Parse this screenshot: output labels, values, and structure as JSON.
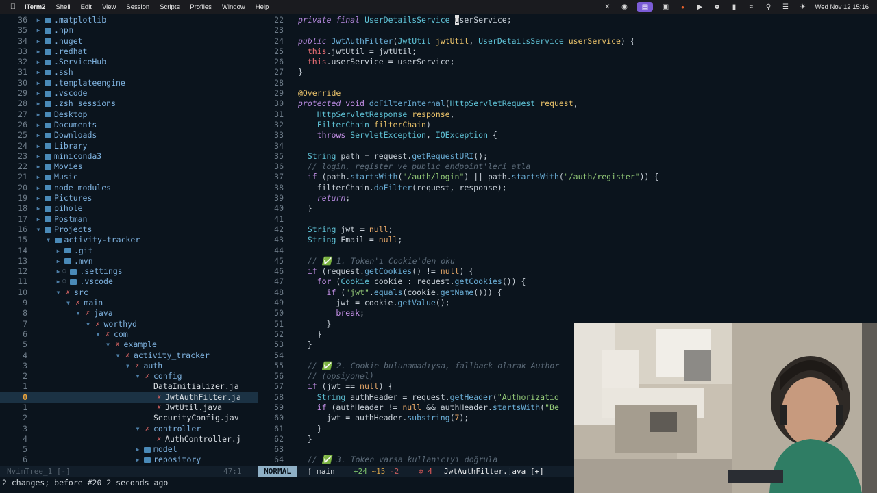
{
  "menubar": {
    "app_name": "iTerm2",
    "items": [
      "Shell",
      "Edit",
      "View",
      "Session",
      "Scripts",
      "Profiles",
      "Window",
      "Help"
    ],
    "clock": "Wed Nov 12  15:16"
  },
  "tree": {
    "rows": [
      {
        "rel": "36",
        "name": ".matplotlib",
        "depth": 0,
        "kind": "dir"
      },
      {
        "rel": "35",
        "name": ".npm",
        "depth": 0,
        "kind": "dir"
      },
      {
        "rel": "34",
        "name": ".nuget",
        "depth": 0,
        "kind": "dir"
      },
      {
        "rel": "33",
        "name": ".redhat",
        "depth": 0,
        "kind": "dir"
      },
      {
        "rel": "32",
        "name": ".ServiceHub",
        "depth": 0,
        "kind": "dir"
      },
      {
        "rel": "31",
        "name": ".ssh",
        "depth": 0,
        "kind": "dir"
      },
      {
        "rel": "30",
        "name": ".templateengine",
        "depth": 0,
        "kind": "dir"
      },
      {
        "rel": "29",
        "name": ".vscode",
        "depth": 0,
        "kind": "dir"
      },
      {
        "rel": "28",
        "name": ".zsh_sessions",
        "depth": 0,
        "kind": "dir"
      },
      {
        "rel": "27",
        "name": "Desktop",
        "depth": 0,
        "kind": "dir"
      },
      {
        "rel": "26",
        "name": "Documents",
        "depth": 0,
        "kind": "dir"
      },
      {
        "rel": "25",
        "name": "Downloads",
        "depth": 0,
        "kind": "dir"
      },
      {
        "rel": "24",
        "name": "Library",
        "depth": 0,
        "kind": "dir"
      },
      {
        "rel": "23",
        "name": "miniconda3",
        "depth": 0,
        "kind": "dir"
      },
      {
        "rel": "22",
        "name": "Movies",
        "depth": 0,
        "kind": "dir"
      },
      {
        "rel": "21",
        "name": "Music",
        "depth": 0,
        "kind": "dir"
      },
      {
        "rel": "20",
        "name": "node_modules",
        "depth": 0,
        "kind": "dir"
      },
      {
        "rel": "19",
        "name": "Pictures",
        "depth": 0,
        "kind": "dir"
      },
      {
        "rel": "18",
        "name": "pihole",
        "depth": 0,
        "kind": "dir"
      },
      {
        "rel": "17",
        "name": "Postman",
        "depth": 0,
        "kind": "dir"
      },
      {
        "rel": "16",
        "name": "Projects",
        "depth": 0,
        "kind": "dir-open"
      },
      {
        "rel": "15",
        "name": "activity-tracker",
        "depth": 1,
        "kind": "dir-open"
      },
      {
        "rel": "14",
        "name": ".git",
        "depth": 2,
        "kind": "dir"
      },
      {
        "rel": "13",
        "name": ".mvn",
        "depth": 2,
        "kind": "dir"
      },
      {
        "rel": "12",
        "name": ".settings",
        "depth": 2,
        "kind": "dir-dot"
      },
      {
        "rel": "11",
        "name": ".vscode",
        "depth": 2,
        "kind": "dir-dot"
      },
      {
        "rel": "10",
        "name": "src",
        "depth": 2,
        "kind": "dir-open-x"
      },
      {
        "rel": "9",
        "name": "main",
        "depth": 3,
        "kind": "dir-open-x"
      },
      {
        "rel": "8",
        "name": "java",
        "depth": 4,
        "kind": "dir-open-x"
      },
      {
        "rel": "7",
        "name": "worthyd",
        "depth": 5,
        "kind": "dir-open-x"
      },
      {
        "rel": "6",
        "name": "com",
        "depth": 6,
        "kind": "dir-open-x"
      },
      {
        "rel": "5",
        "name": "example",
        "depth": 7,
        "kind": "dir-open-x"
      },
      {
        "rel": "4",
        "name": "activity_tracker",
        "depth": 8,
        "kind": "dir-open-x"
      },
      {
        "rel": "3",
        "name": "auth",
        "depth": 9,
        "kind": "dir-open-x"
      },
      {
        "rel": "2",
        "name": "config",
        "depth": 10,
        "kind": "dir-open-x"
      },
      {
        "rel": "1",
        "name": "DataInitializer.ja",
        "depth": 12,
        "kind": "file"
      },
      {
        "rel": "0",
        "name": "JwtAuthFilter.ja",
        "depth": 12,
        "kind": "file-x",
        "current": true
      },
      {
        "rel": "1",
        "name": "JwtUtil.java",
        "depth": 12,
        "kind": "file-x"
      },
      {
        "rel": "2",
        "name": "SecurityConfig.jav",
        "depth": 12,
        "kind": "file"
      },
      {
        "rel": "3",
        "name": "controller",
        "depth": 10,
        "kind": "dir-open-x"
      },
      {
        "rel": "4",
        "name": "AuthController.j",
        "depth": 12,
        "kind": "file-x"
      },
      {
        "rel": "5",
        "name": "model",
        "depth": 10,
        "kind": "dir"
      },
      {
        "rel": "6",
        "name": "repository",
        "depth": 10,
        "kind": "dir"
      }
    ]
  },
  "code": {
    "lines": [
      {
        "n": "22",
        "src": "<span class='k'>private final</span> <span class='t'>UserDetailsService</span> <span class='cursor'>u</span>serService;"
      },
      {
        "n": "23",
        "src": ""
      },
      {
        "n": "24",
        "src": "<span class='k'>public</span> <span class='f'>JwtAuthFilter</span>(<span class='t'>JwtUtil</span> <span class='a'>jwtUtil</span>, <span class='t'>UserDetailsService</span> <span class='a'>userService</span>) {"
      },
      {
        "n": "25",
        "src": "  <span class='p'>this</span>.jwtUtil = jwtUtil;"
      },
      {
        "n": "26",
        "src": "  <span class='p'>this</span>.userService = userService;"
      },
      {
        "n": "27",
        "src": "}"
      },
      {
        "n": "28",
        "src": ""
      },
      {
        "n": "29",
        "src": "<span class='a'>@Override</span>"
      },
      {
        "n": "30",
        "src": "<span class='k'>protected</span> <span class='kw'>void</span> <span class='f'>doFilterInternal</span>(<span class='t'>HttpServletRequest</span> <span class='a'>request</span>,"
      },
      {
        "n": "31",
        "src": "    <span class='t'>HttpServletResponse</span> <span class='a'>response</span>,"
      },
      {
        "n": "32",
        "src": "    <span class='t'>FilterChain</span> <span class='a'>filterChain</span>)"
      },
      {
        "n": "33",
        "src": "    <span class='kw'>throws</span> <span class='t'>ServletException</span>, <span class='t'>IOException</span> {"
      },
      {
        "n": "34",
        "src": ""
      },
      {
        "n": "35",
        "src": "  <span class='t'>String</span> path = request.<span class='f'>getRequestURI</span>();"
      },
      {
        "n": "36",
        "src": "  <span class='c'>// login, register ve public endpoint'leri atla</span>"
      },
      {
        "n": "37",
        "src": "  <span class='kw'>if</span> (path.<span class='f'>startsWith</span>(<span class='s'>\"/auth/login\"</span>) || path.<span class='f'>startsWith</span>(<span class='s'>\"/auth/register\"</span>)) {"
      },
      {
        "n": "38",
        "src": "    filterChain.<span class='f'>doFilter</span>(request, response);"
      },
      {
        "n": "39",
        "src": "    <span class='k'>return</span>;"
      },
      {
        "n": "40",
        "src": "  }"
      },
      {
        "n": "41",
        "src": ""
      },
      {
        "n": "42",
        "src": "  <span class='t'>String</span> jwt = <span class='n'>null</span>;"
      },
      {
        "n": "43",
        "src": "  <span class='t'>String</span> Email = <span class='n'>null</span>;"
      },
      {
        "n": "44",
        "src": ""
      },
      {
        "n": "45",
        "src": "  <span class='c'>// ✅ 1. Token'ı Cookie'den oku</span>"
      },
      {
        "n": "46",
        "src": "  <span class='kw'>if</span> (request.<span class='f'>getCookies</span>() != <span class='n'>null</span>) {"
      },
      {
        "n": "47",
        "src": "    <span class='kw'>for</span> (<span class='t'>Cookie</span> cookie : request.<span class='f'>getCookies</span>()) {"
      },
      {
        "n": "48",
        "src": "      <span class='kw'>if</span> (<span class='s'>\"jwt\"</span>.<span class='f'>equals</span>(cookie.<span class='f'>getName</span>())) {"
      },
      {
        "n": "49",
        "src": "        jwt = cookie.<span class='f'>getValue</span>();"
      },
      {
        "n": "50",
        "src": "        <span class='kw'>break</span>;"
      },
      {
        "n": "51",
        "src": "      }"
      },
      {
        "n": "52",
        "src": "    }"
      },
      {
        "n": "53",
        "src": "  }"
      },
      {
        "n": "54",
        "src": ""
      },
      {
        "n": "55",
        "src": "  <span class='c'>// ✅ 2. Cookie bulunamadıysa, fallback olarak Author</span>"
      },
      {
        "n": "56",
        "src": "  <span class='c'>// (opsiyonel)</span>"
      },
      {
        "n": "57",
        "src": "  <span class='kw'>if</span> (jwt == <span class='n'>null</span>) {"
      },
      {
        "n": "58",
        "src": "    <span class='t'>String</span> authHeader = request.<span class='f'>getHeader</span>(<span class='s'>\"Authorizatio</span>"
      },
      {
        "n": "59",
        "src": "    <span class='kw'>if</span> (authHeader != <span class='n'>null</span> && authHeader.<span class='f'>startsWith</span>(<span class='s'>\"Be</span>"
      },
      {
        "n": "60",
        "src": "      jwt = authHeader.<span class='f'>substring</span>(<span class='n'>7</span>);"
      },
      {
        "n": "61",
        "src": "    }"
      },
      {
        "n": "62",
        "src": "  }"
      },
      {
        "n": "63",
        "src": ""
      },
      {
        "n": "64",
        "src": "  <span class='c'>// ✅ 3. Token varsa kullanıcıyı doğrula</span>"
      }
    ]
  },
  "statusline": {
    "tree_label": "NvimTree_1 [-]",
    "tree_pos": "47:1",
    "mode": "NORMAL",
    "branch": "ᚴ main",
    "diff_add": "+24",
    "diff_mod": "~15",
    "diff_del": "-2",
    "errors": "⊗ 4",
    "filename": "JwtAuthFilter.java [+]"
  },
  "message": "2 changes; before #20  2 seconds ago"
}
